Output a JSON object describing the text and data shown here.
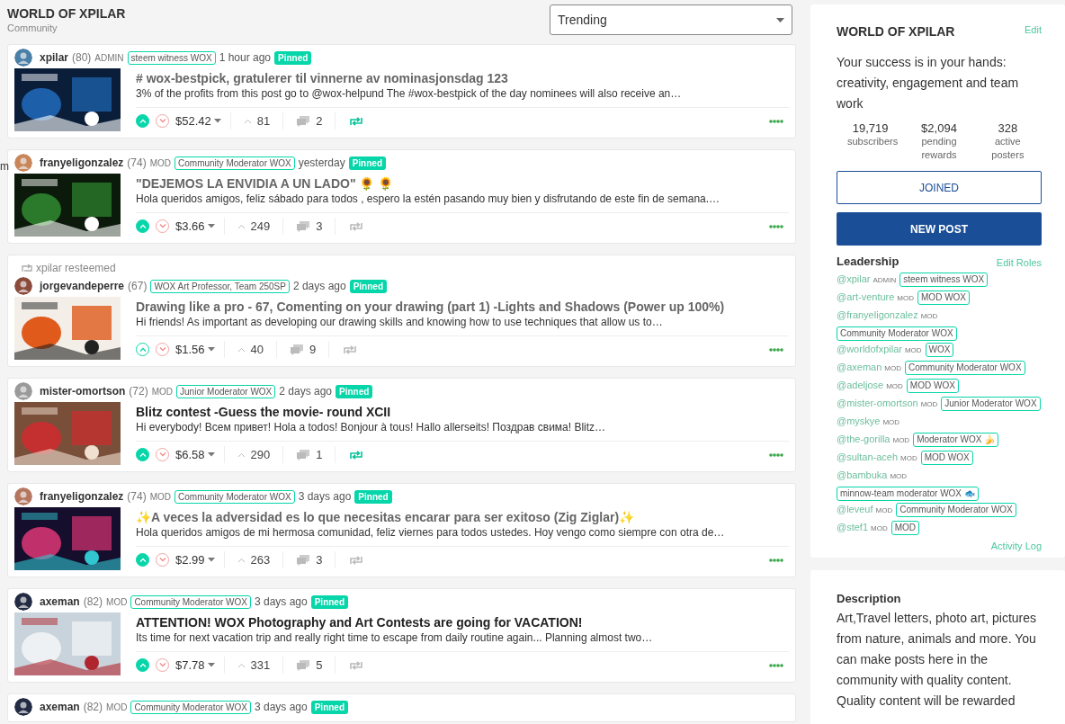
{
  "header": {
    "title": "WORLD OF XPILAR",
    "subtitle": "Community",
    "sort": "Trending"
  },
  "edge_fragment": "m",
  "posts": [
    {
      "author": "xpilar",
      "reputation": "(80)",
      "role": "ADMIN",
      "badge": "steem witness WOX",
      "time": "1 hour ago",
      "pinned": "Pinned",
      "title": "# wox-bestpick, gratulerer til vinnerne av nominasjonsdag 123",
      "body": "3% of the profits from this post go to @wox-helpund The #wox-bestpick of the day nominees will also receive an…",
      "payout": "$52.42",
      "votes": "81",
      "comments": "2",
      "upvoted": true,
      "visited": true,
      "resteemed": true
    },
    {
      "author": "franyeligonzalez",
      "reputation": "(74)",
      "role": "MOD",
      "badge": "Community Moderator WOX",
      "time": "yesterday",
      "pinned": "Pinned",
      "title": "\"DEJEMOS LA ENVIDIA A UN LADO\" 🌻 🌻",
      "body": "Hola queridos amigos, feliz sábado para todos , espero la estén pasando muy bien y disfrutando de este fin de semana.…",
      "payout": "$3.66",
      "votes": "249",
      "comments": "3",
      "upvoted": true,
      "visited": true,
      "resteemed": false
    },
    {
      "resteem_note": "xpilar resteemed",
      "author": "jorgevandeperre",
      "reputation": "(67)",
      "badge": "WOX Art Professor, Team 250SP",
      "time": "2 days ago",
      "pinned": "Pinned",
      "title": "Drawing like a pro - 67, Comenting on your drawing (part 1) -Lights and Shadows (Power up 100%)",
      "body": "Hi friends! As important as developing our drawing skills and knowing how to use techniques that allow us to…",
      "payout": "$1.56",
      "votes": "40",
      "comments": "9",
      "upvoted": false,
      "visited": true,
      "resteemed": false
    },
    {
      "author": "mister-omortson",
      "reputation": "(72)",
      "role": "MOD",
      "badge": "Junior Moderator WOX",
      "time": "2 days ago",
      "pinned": "Pinned",
      "title": "Blitz contest -Guess the movie- round XCII",
      "body": "Hi everybody! Всем привет! Hola a todos! Bonjour à tous! Hallo allerseits! Поздрав свима! Blitz…",
      "payout": "$6.58",
      "votes": "290",
      "comments": "1",
      "upvoted": true,
      "visited": false,
      "resteemed": true
    },
    {
      "author": "franyeligonzalez",
      "reputation": "(74)",
      "role": "MOD",
      "badge": "Community Moderator WOX",
      "time": "3 days ago",
      "pinned": "Pinned",
      "title": "✨A veces la adversidad es lo que necesitas encarar para ser exitoso (Zig Ziglar)✨",
      "body": "Hola queridos amigos de mi hermosa comunidad, feliz viernes para todos ustedes. Hoy vengo como siempre con otra de…",
      "payout": "$2.99",
      "votes": "263",
      "comments": "3",
      "upvoted": true,
      "visited": true,
      "resteemed": false
    },
    {
      "author": "axeman",
      "reputation": "(82)",
      "role": "MOD",
      "badge": "Community Moderator WOX",
      "time": "3 days ago",
      "pinned": "Pinned",
      "title": "ATTENTION! WOX Photography and Art Contests are going for VACATION!",
      "body": "Its time for next vacation trip and really right time to escape from daily routine again... Planning almost two…",
      "payout": "$7.78",
      "votes": "331",
      "comments": "5",
      "upvoted": true,
      "visited": false,
      "resteemed": false
    },
    {
      "author": "axeman",
      "reputation": "(82)",
      "role": "MOD",
      "badge": "Community Moderator WOX",
      "time": "3 days ago",
      "pinned": "Pinned"
    }
  ],
  "sidebar": {
    "title": "WORLD OF XPILAR",
    "edit": "Edit",
    "about": "Your success is in your hands: creativity, engagement and team work",
    "stats": [
      {
        "value": "19,719",
        "label": "subscribers"
      },
      {
        "value": "$2,094",
        "label": "pending rewards"
      },
      {
        "value": "328",
        "label": "active posters"
      }
    ],
    "join_button": "JOINED",
    "new_post_button": "NEW POST",
    "leadership_title": "Leadership",
    "edit_roles": "Edit Roles",
    "leaders": [
      {
        "name": "@xpilar",
        "role": "ADMIN",
        "badge": "steem witness WOX"
      },
      {
        "name": "@art-venture",
        "role": "MOD",
        "badge": "MOD WOX"
      },
      {
        "name": "@franyeligonzalez",
        "role": "MOD",
        "badge": "Community Moderator WOX"
      },
      {
        "name": "@worldofxpilar",
        "role": "MOD",
        "badge": "WOX"
      },
      {
        "name": "@axeman",
        "role": "MOD",
        "badge": "Community Moderator WOX"
      },
      {
        "name": "@adeljose",
        "role": "MOD",
        "badge": "MOD WOX"
      },
      {
        "name": "@mister-omortson",
        "role": "MOD",
        "badge": "Junior Moderator WOX"
      },
      {
        "name": "@myskye",
        "role": "MOD"
      },
      {
        "name": "@the-gorilla",
        "role": "MOD",
        "badge": "Moderator WOX 🍌"
      },
      {
        "name": "@sultan-aceh",
        "role": "MOD",
        "badge": "MOD WOX"
      },
      {
        "name": "@bambuka",
        "role": "MOD",
        "badge": "minnow-team moderator WOX 🐟"
      },
      {
        "name": "@leveuf",
        "role": "MOD",
        "badge": "Community Moderator WOX"
      },
      {
        "name": "@stef1",
        "role": "MOD",
        "badge": "MOD"
      }
    ],
    "activity_log": "Activity Log",
    "description_title": "Description",
    "description": "Art,Travel letters, photo art, pictures from nature, animals and more. You can make posts here in the community with quality content. Quality content will be rewarded"
  }
}
